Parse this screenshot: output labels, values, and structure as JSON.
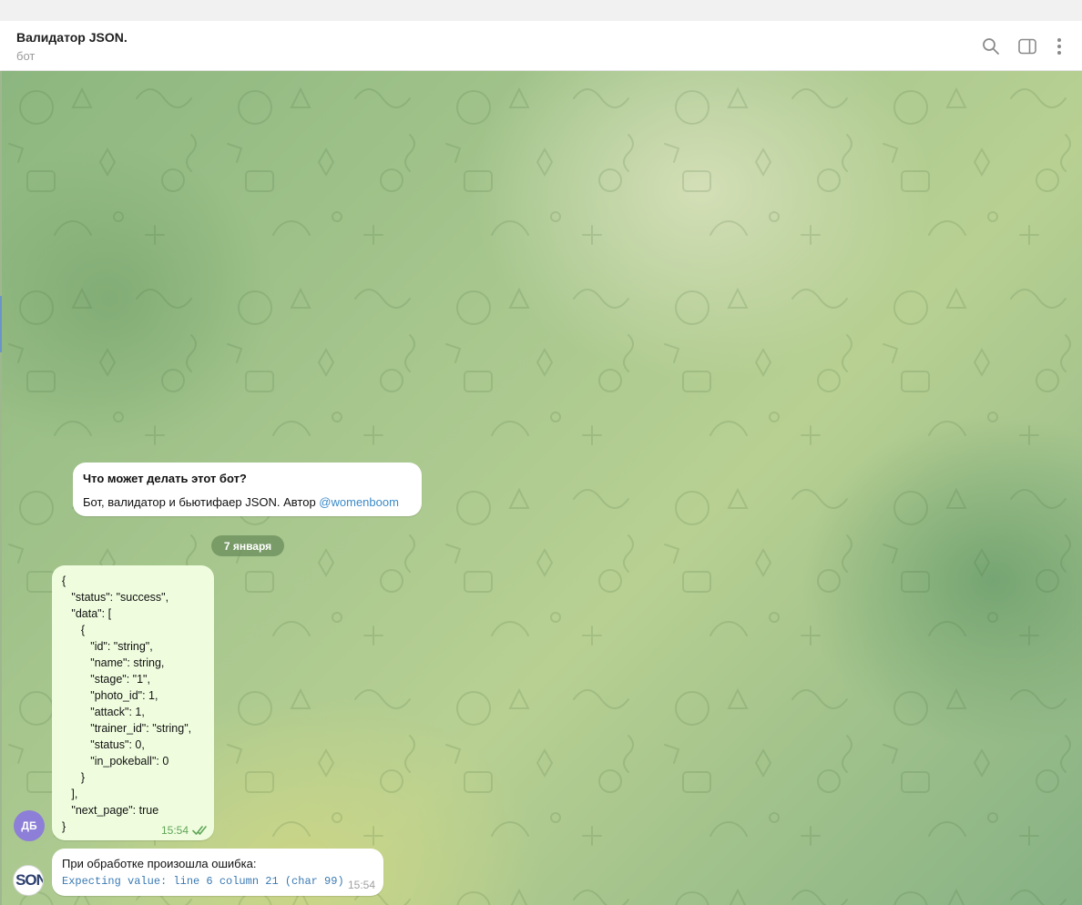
{
  "header": {
    "title": "Валидатор JSON.",
    "subtitle": "бот",
    "icons": [
      "search-icon",
      "sidebar-toggle-icon",
      "more-vertical-icon"
    ]
  },
  "intro": {
    "heading": "Что может делать этот бот?",
    "description_prefix": "Бот, валидатор и бьютифаер JSON. Автор ",
    "author_link": "@womenboom"
  },
  "date_separator": "7 января",
  "outgoing_message": {
    "text": "{\n   \"status\": \"success\",\n   \"data\": [\n      {\n         \"id\": \"string\",\n         \"name\": string,\n         \"stage\": \"1\",\n         \"photo_id\": 1,\n         \"attack\": 1,\n         \"trainer_id\": \"string\",\n         \"status\": 0,\n         \"in_pokeball\": 0\n      }\n   ],\n   \"next_page\": true\n}",
    "time": "15:54",
    "status": "read",
    "avatar_initials": "ДБ"
  },
  "incoming_message": {
    "line1": "При обработке произошла ошибка:",
    "line2": "Expecting value: line 6 column 21 (char 99)",
    "time": "15:54",
    "avatar_text": "SON"
  },
  "colors": {
    "accent": "#3a8ac8",
    "outgoing_bubble": "#effdde",
    "read_check": "#5fa557",
    "user_avatar": "#8d7ed8"
  }
}
